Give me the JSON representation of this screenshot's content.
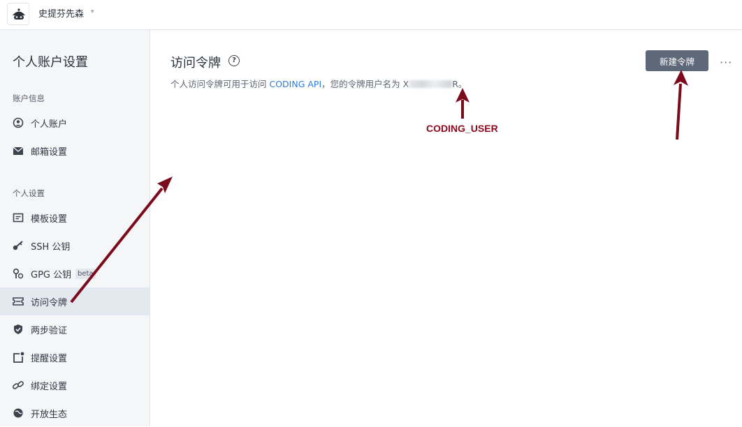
{
  "topbar": {
    "team_name": "史提芬先森",
    "caret": "▾"
  },
  "sidebar": {
    "title": "个人账户设置",
    "section_account": "账户信息",
    "section_personal": "个人设置",
    "items": [
      {
        "label": "个人账户",
        "icon": "user-circle-icon"
      },
      {
        "label": "邮箱设置",
        "icon": "envelope-icon"
      },
      {
        "label": "模板设置",
        "icon": "template-icon"
      },
      {
        "label": "SSH 公钥",
        "icon": "key-icon"
      },
      {
        "label": "GPG 公钥",
        "icon": "gpg-key-icon",
        "badge": "beta"
      },
      {
        "label": "访问令牌",
        "icon": "ticket-icon",
        "active": true
      },
      {
        "label": "两步验证",
        "icon": "shield-check-icon"
      },
      {
        "label": "提醒设置",
        "icon": "notification-icon"
      },
      {
        "label": "绑定设置",
        "icon": "link-icon"
      },
      {
        "label": "开放生态",
        "icon": "globe-icon"
      }
    ]
  },
  "main": {
    "title": "访问令牌",
    "help": "?",
    "desc_prefix": "个人访问令牌可用于访问 ",
    "desc_link": "CODING API",
    "desc_middle": "，您的令牌用户名为 X",
    "desc_suffix": "R。",
    "new_token_button": "新建令牌",
    "more": "···"
  },
  "annotation": {
    "label": "CODING_USER",
    "color": "#8b0a1e"
  }
}
